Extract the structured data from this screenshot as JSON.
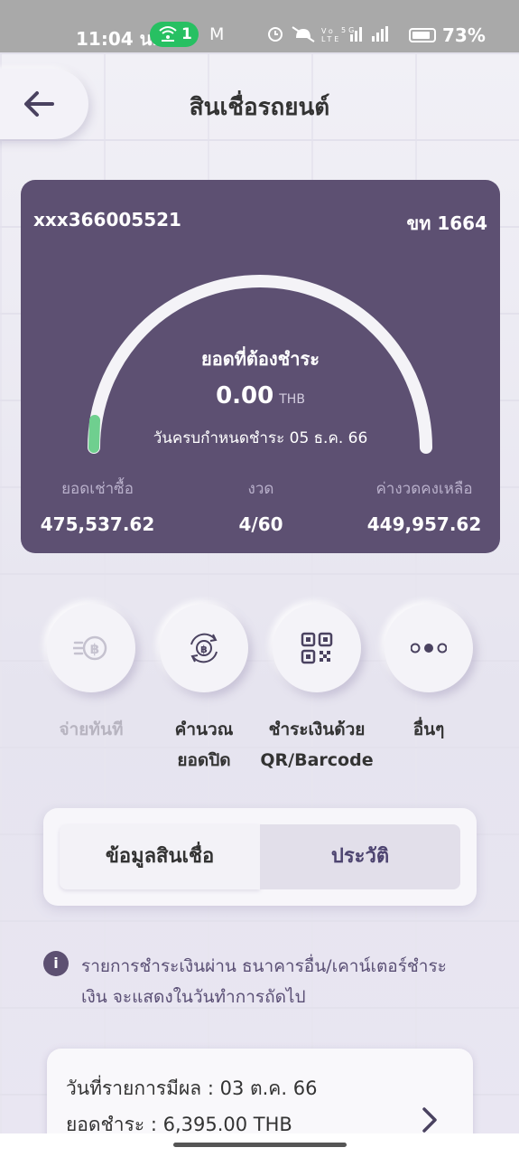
{
  "status_bar": {
    "time": "11:04 น.",
    "hotspot_count": "1",
    "mail_icon": "M",
    "icons_text": "⏰ 🔕 Vo ⁵ᴳ ıl ıl",
    "battery_pct": "73%"
  },
  "header": {
    "back_icon": "arrow-left-icon",
    "title": "สินเชื่อรถยนต์"
  },
  "loan_card": {
    "account": "xxx366005521",
    "plate": "ขท 1664",
    "gauge_fraction": 0.0,
    "due_label": "ยอดที่ต้องชำระ",
    "due_amount": "0.00",
    "currency": "THB",
    "due_date": "วันครบกำหนดชำระ 05 ธ.ค. 66",
    "stats": [
      {
        "label": "ยอดเช่าซื้อ",
        "value": "475,537.62"
      },
      {
        "label": "งวด",
        "value": "4/60"
      },
      {
        "label": "ค่างวดคงเหลือ",
        "value": "449,957.62"
      }
    ],
    "colors": {
      "card": "#5d5072",
      "gauge_track": "#f4f3f7",
      "gauge_fill": "#6fcf8f"
    }
  },
  "actions": [
    {
      "icon": "pay-baht-icon",
      "label1": "จ่ายทันที",
      "label2": "",
      "disabled": true
    },
    {
      "icon": "calculate-baht-icon",
      "label1": "คำนวณ",
      "label2": "ยอดปิด",
      "disabled": false
    },
    {
      "icon": "qr-code-icon",
      "label1": "ชำระเงินด้วย",
      "label2": "QR/Barcode",
      "disabled": false
    },
    {
      "icon": "more-icon",
      "label1": "อื่นๆ",
      "label2": "",
      "disabled": false
    }
  ],
  "tabs": {
    "active": "ข้อมูลสินเชื่อ",
    "inactive": "ประวัติ"
  },
  "notice": {
    "icon": "i",
    "line1": "รายการชำระเงินผ่าน ธนาคารอื่น/เคาน์เตอร์ชำระ",
    "line2": "เงิน จะแสดงในวันทำการถัดไป"
  },
  "history": {
    "date": "วันที่รายการมีผล : 03 ต.ค. 66",
    "paid": "ยอดชำระ : 6,395.00 THB"
  }
}
